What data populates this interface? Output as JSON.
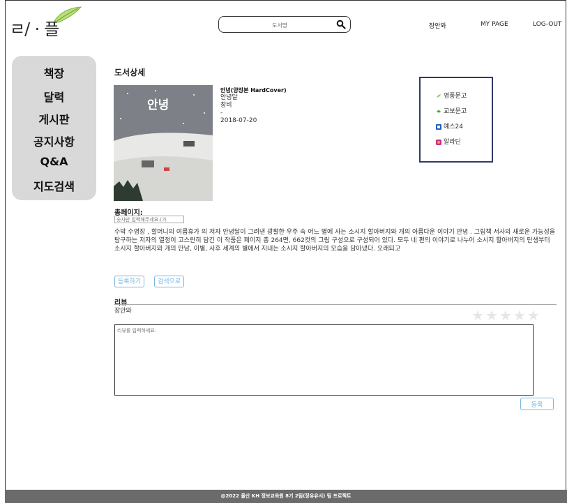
{
  "header": {
    "logo_text": "ㄹ/ㆍ플",
    "search_placeholder": "도서명",
    "nav": [
      "장안와",
      "MY PAGE",
      "LOG-OUT"
    ]
  },
  "sidebar": {
    "items": [
      "책장",
      "달력",
      "게시판",
      "공지사항",
      "Q&A",
      "지도검색"
    ]
  },
  "main": {
    "section_title": "도서상세",
    "book": {
      "cover_title": "안녕",
      "title": "안녕(양장본 HardCover)",
      "author": "안녕달",
      "publisher": "창비",
      "dash": "-",
      "date": "2018-07-20"
    },
    "stores": [
      "영풍문고",
      "교보문고",
      "예스24",
      "알라딘"
    ],
    "pages_label": "총페이지:",
    "pages_placeholder": "숫자만 입력해주세요.(가",
    "description": "수박 수영장  ,  할머니의 여름휴가  의 저자 안녕달이 그려낸 광활한 우주 속 어느 별에 사는 소시지 할아버지와 개의 아름다운 이야기  안녕  . 그림책 서사의 새로운 가능성을 탐구하는 저자의 열정이 고스란히 담긴 이 작품은 페이지 총 264면, 662컷의 그림 구성으로 구성되어 있다. 모두 네 편의 이야기로 나누어 소시지 할아버지의 탄생부터 소시지 할아버지와 개의 만남, 이별, 사후 세계의 별에서 지내는 소시지 할아버지의 모습을 담아냈다. 오래되고",
    "buttons": [
      "등록하기",
      "검색으로"
    ],
    "review": {
      "title": "리뷰",
      "user": "장안와",
      "placeholder": "리뷰를 입력하세요.",
      "submit": "등록"
    }
  },
  "footer": {
    "text": "@2022 울산 KH 정보교육원 8기 2팀(장유유서) 팀 프로젝트"
  },
  "colors": {
    "accent": "#7ab7e0",
    "store_border": "#2d3a6b",
    "sidebar_bg": "#d9d9d9",
    "footer_bg": "#6b6b6b"
  }
}
